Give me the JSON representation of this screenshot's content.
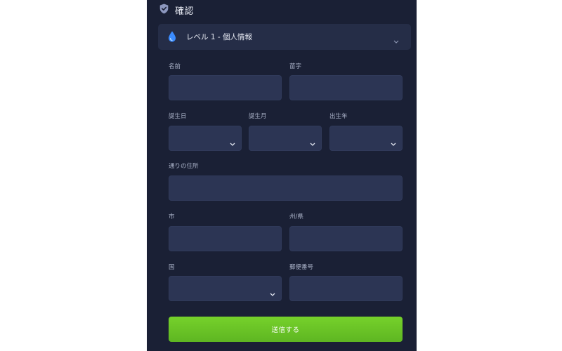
{
  "header": {
    "title": "確認",
    "icon": "shield-check-icon"
  },
  "section": {
    "title": "レベル 1 - 個人情報",
    "icon": "water-drop-icon",
    "expand_icon": "chevron-down-icon",
    "accent": "#3b8cff"
  },
  "form": {
    "first_name": {
      "label": "名前",
      "value": ""
    },
    "last_name": {
      "label": "苗字",
      "value": ""
    },
    "birth_day": {
      "label": "誕生日",
      "value": ""
    },
    "birth_month": {
      "label": "誕生月",
      "value": ""
    },
    "birth_year": {
      "label": "出生年",
      "value": ""
    },
    "street_address": {
      "label": "通りの住所",
      "value": ""
    },
    "city": {
      "label": "市",
      "value": ""
    },
    "state": {
      "label": "州/県",
      "value": ""
    },
    "country": {
      "label": "国",
      "value": ""
    },
    "postal_code": {
      "label": "郵便番号",
      "value": ""
    }
  },
  "submit": {
    "label": "送信する",
    "color": "#6cc426"
  },
  "colors": {
    "panel_bg": "#1a2035",
    "input_bg": "#2c3554"
  }
}
